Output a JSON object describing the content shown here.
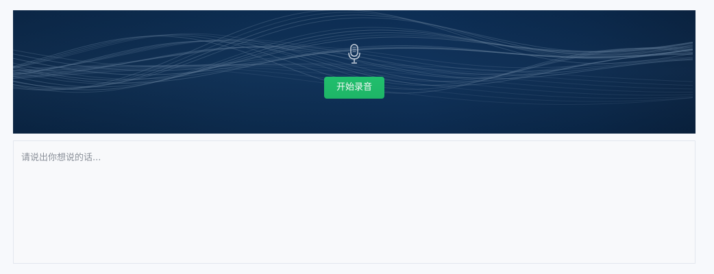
{
  "recorder": {
    "mic_icon": "microphone-icon",
    "start_button_label": "开始录音"
  },
  "transcript": {
    "placeholder": "请说出你想说的话...",
    "value": ""
  },
  "colors": {
    "banner_dark": "#0b2849",
    "button_green": "#1dbf6b",
    "wave_line": "#5c7896"
  }
}
